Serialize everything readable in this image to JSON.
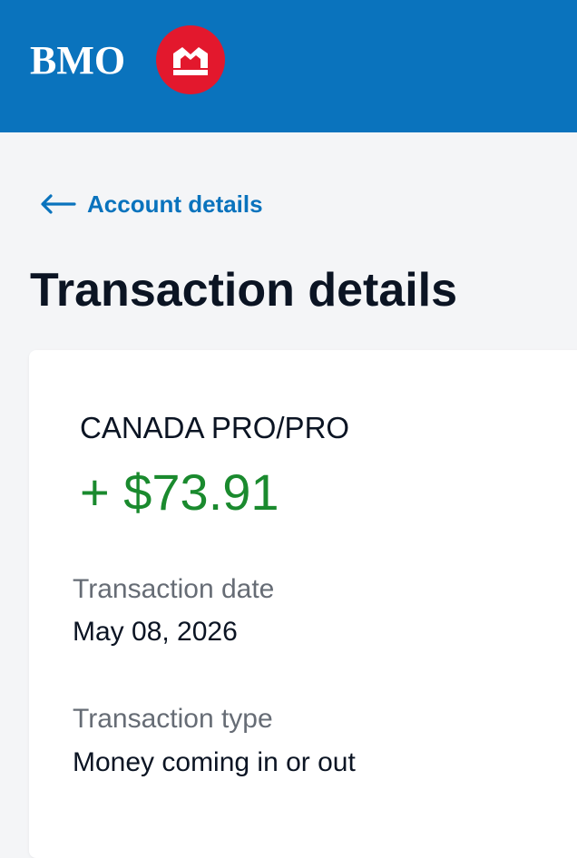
{
  "header": {
    "logo_text": "BMO",
    "brand_color": "#0a73bd",
    "roundel_color": "#e3182d",
    "roundel_icon": "bmo-m-bar-icon"
  },
  "navigation": {
    "back_icon": "arrow-left-icon",
    "back_label": "Account details"
  },
  "page": {
    "title": "Transaction details"
  },
  "transaction": {
    "merchant": "CANADA PRO/PRO",
    "amount": "+ $73.91",
    "amount_color": "#1a8a2e",
    "fields": [
      {
        "label": "Transaction date",
        "value": "May 08, 2026"
      },
      {
        "label": "Transaction type",
        "value": "Money coming in or out"
      }
    ]
  }
}
